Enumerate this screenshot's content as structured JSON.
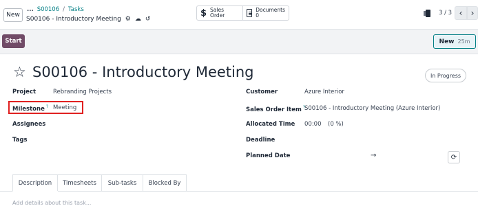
{
  "control_panel": {
    "new_label": "New",
    "breadcrumb_dots": "...",
    "breadcrumb_parent": "S00106",
    "breadcrumb_sep": "/",
    "breadcrumb_current": "Tasks",
    "record_name": "S00106 - Introductory Meeting",
    "pager": "3 / 3"
  },
  "smart_buttons": {
    "sales_order_label": "Sales Order",
    "documents_label": "Documents",
    "documents_count": "0"
  },
  "status_bar": {
    "start_label": "Start",
    "timer_label": "New",
    "timer_value": "25m"
  },
  "form": {
    "title": "S00106 - Introductory Meeting",
    "stage": "In Progress",
    "left_fields": [
      {
        "label": "Project",
        "value": "Rebranding Projects"
      },
      {
        "label": "Milestone",
        "help": "?",
        "value": "Meeting"
      },
      {
        "label": "Assignees",
        "value": ""
      },
      {
        "label": "Tags",
        "value": ""
      }
    ],
    "right_fields": [
      {
        "label": "Customer",
        "value": "Azure Interior"
      },
      {
        "label": "Sales Order Item",
        "help": "?",
        "value": "S00106 - Introductory Meeting (Azure Interior)"
      },
      {
        "label": "Allocated Time",
        "value": "00:00",
        "extra": "(0 %)"
      },
      {
        "label": "Deadline",
        "value": ""
      },
      {
        "label": "Planned Date",
        "value": "→"
      }
    ]
  },
  "tabs": [
    "Description",
    "Timesheets",
    "Sub-tasks",
    "Blocked By"
  ],
  "description_placeholder": "Add details about this task...",
  "colors": {
    "primary": "#714b67",
    "link": "#017e84",
    "highlight": "#e02020"
  },
  "icons": [
    "gear-icon",
    "cloud-upload-icon",
    "undo-icon",
    "dollar-icon",
    "document-icon",
    "pager-icon",
    "chevron-left-icon",
    "chevron-right-icon",
    "star-icon",
    "arrow-right-icon",
    "reset-icon"
  ]
}
